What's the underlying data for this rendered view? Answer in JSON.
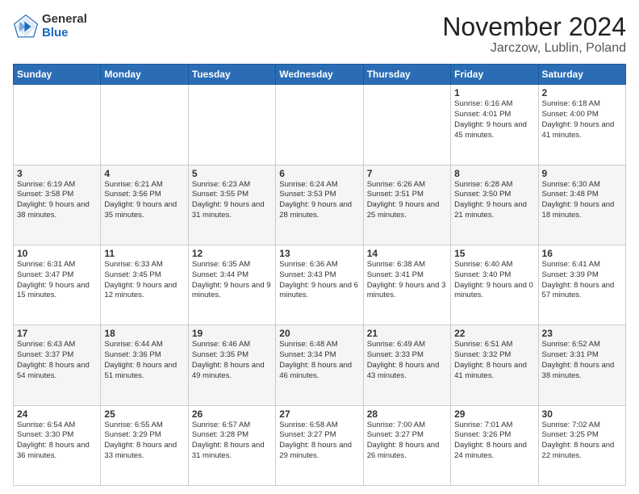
{
  "logo": {
    "general": "General",
    "blue": "Blue"
  },
  "title": "November 2024",
  "subtitle": "Jarczow, Lublin, Poland",
  "weekdays": [
    "Sunday",
    "Monday",
    "Tuesday",
    "Wednesday",
    "Thursday",
    "Friday",
    "Saturday"
  ],
  "weeks": [
    [
      {
        "day": "",
        "info": ""
      },
      {
        "day": "",
        "info": ""
      },
      {
        "day": "",
        "info": ""
      },
      {
        "day": "",
        "info": ""
      },
      {
        "day": "",
        "info": ""
      },
      {
        "day": "1",
        "info": "Sunrise: 6:16 AM\nSunset: 4:01 PM\nDaylight: 9 hours and 45 minutes."
      },
      {
        "day": "2",
        "info": "Sunrise: 6:18 AM\nSunset: 4:00 PM\nDaylight: 9 hours and 41 minutes."
      }
    ],
    [
      {
        "day": "3",
        "info": "Sunrise: 6:19 AM\nSunset: 3:58 PM\nDaylight: 9 hours and 38 minutes."
      },
      {
        "day": "4",
        "info": "Sunrise: 6:21 AM\nSunset: 3:56 PM\nDaylight: 9 hours and 35 minutes."
      },
      {
        "day": "5",
        "info": "Sunrise: 6:23 AM\nSunset: 3:55 PM\nDaylight: 9 hours and 31 minutes."
      },
      {
        "day": "6",
        "info": "Sunrise: 6:24 AM\nSunset: 3:53 PM\nDaylight: 9 hours and 28 minutes."
      },
      {
        "day": "7",
        "info": "Sunrise: 6:26 AM\nSunset: 3:51 PM\nDaylight: 9 hours and 25 minutes."
      },
      {
        "day": "8",
        "info": "Sunrise: 6:28 AM\nSunset: 3:50 PM\nDaylight: 9 hours and 21 minutes."
      },
      {
        "day": "9",
        "info": "Sunrise: 6:30 AM\nSunset: 3:48 PM\nDaylight: 9 hours and 18 minutes."
      }
    ],
    [
      {
        "day": "10",
        "info": "Sunrise: 6:31 AM\nSunset: 3:47 PM\nDaylight: 9 hours and 15 minutes."
      },
      {
        "day": "11",
        "info": "Sunrise: 6:33 AM\nSunset: 3:45 PM\nDaylight: 9 hours and 12 minutes."
      },
      {
        "day": "12",
        "info": "Sunrise: 6:35 AM\nSunset: 3:44 PM\nDaylight: 9 hours and 9 minutes."
      },
      {
        "day": "13",
        "info": "Sunrise: 6:36 AM\nSunset: 3:43 PM\nDaylight: 9 hours and 6 minutes."
      },
      {
        "day": "14",
        "info": "Sunrise: 6:38 AM\nSunset: 3:41 PM\nDaylight: 9 hours and 3 minutes."
      },
      {
        "day": "15",
        "info": "Sunrise: 6:40 AM\nSunset: 3:40 PM\nDaylight: 9 hours and 0 minutes."
      },
      {
        "day": "16",
        "info": "Sunrise: 6:41 AM\nSunset: 3:39 PM\nDaylight: 8 hours and 57 minutes."
      }
    ],
    [
      {
        "day": "17",
        "info": "Sunrise: 6:43 AM\nSunset: 3:37 PM\nDaylight: 8 hours and 54 minutes."
      },
      {
        "day": "18",
        "info": "Sunrise: 6:44 AM\nSunset: 3:36 PM\nDaylight: 8 hours and 51 minutes."
      },
      {
        "day": "19",
        "info": "Sunrise: 6:46 AM\nSunset: 3:35 PM\nDaylight: 8 hours and 49 minutes."
      },
      {
        "day": "20",
        "info": "Sunrise: 6:48 AM\nSunset: 3:34 PM\nDaylight: 8 hours and 46 minutes."
      },
      {
        "day": "21",
        "info": "Sunrise: 6:49 AM\nSunset: 3:33 PM\nDaylight: 8 hours and 43 minutes."
      },
      {
        "day": "22",
        "info": "Sunrise: 6:51 AM\nSunset: 3:32 PM\nDaylight: 8 hours and 41 minutes."
      },
      {
        "day": "23",
        "info": "Sunrise: 6:52 AM\nSunset: 3:31 PM\nDaylight: 8 hours and 38 minutes."
      }
    ],
    [
      {
        "day": "24",
        "info": "Sunrise: 6:54 AM\nSunset: 3:30 PM\nDaylight: 8 hours and 36 minutes."
      },
      {
        "day": "25",
        "info": "Sunrise: 6:55 AM\nSunset: 3:29 PM\nDaylight: 8 hours and 33 minutes."
      },
      {
        "day": "26",
        "info": "Sunrise: 6:57 AM\nSunset: 3:28 PM\nDaylight: 8 hours and 31 minutes."
      },
      {
        "day": "27",
        "info": "Sunrise: 6:58 AM\nSunset: 3:27 PM\nDaylight: 8 hours and 29 minutes."
      },
      {
        "day": "28",
        "info": "Sunrise: 7:00 AM\nSunset: 3:27 PM\nDaylight: 8 hours and 26 minutes."
      },
      {
        "day": "29",
        "info": "Sunrise: 7:01 AM\nSunset: 3:26 PM\nDaylight: 8 hours and 24 minutes."
      },
      {
        "day": "30",
        "info": "Sunrise: 7:02 AM\nSunset: 3:25 PM\nDaylight: 8 hours and 22 minutes."
      }
    ]
  ]
}
